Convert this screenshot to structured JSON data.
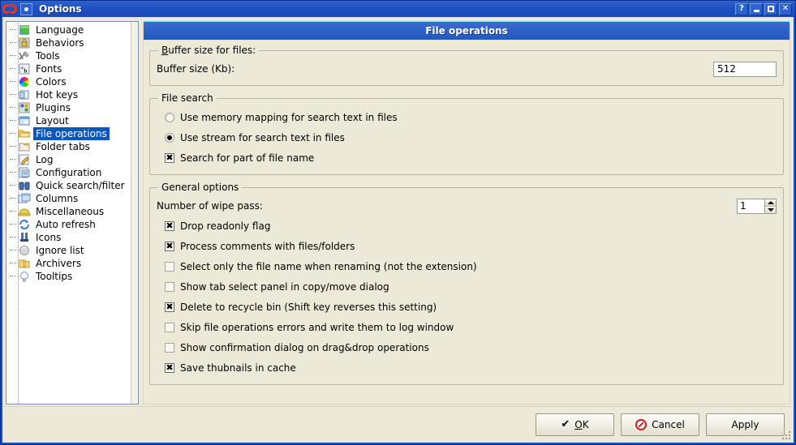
{
  "window": {
    "title": "Options",
    "app_icon": "double-c-app-icon",
    "buttons": {
      "help": "?",
      "minimize": "minimize",
      "maximize": "maximize",
      "close": "✕"
    }
  },
  "sidebar": {
    "selected": "File operations",
    "items": [
      {
        "label": "Language",
        "icon": "green-flag-icon"
      },
      {
        "label": "Behaviors",
        "icon": "lock-icon"
      },
      {
        "label": "Tools",
        "icon": "tools-icon"
      },
      {
        "label": "Fonts",
        "icon": "font-ab-icon"
      },
      {
        "label": "Colors",
        "icon": "color-wheel-icon"
      },
      {
        "label": "Hot keys",
        "icon": "keyboard-key-icon"
      },
      {
        "label": "Plugins",
        "icon": "plugin-blocks-icon"
      },
      {
        "label": "Layout",
        "icon": "layout-window-icon"
      },
      {
        "label": "File operations",
        "icon": "open-folder-icon"
      },
      {
        "label": "Folder tabs",
        "icon": "folder-tab-icon"
      },
      {
        "label": "Log",
        "icon": "pencil-note-icon"
      },
      {
        "label": "Configuration",
        "icon": "config-doc-icon"
      },
      {
        "label": "Quick search/filter",
        "icon": "binoculars-icon"
      },
      {
        "label": "Columns",
        "icon": "columns-icon"
      },
      {
        "label": "Miscellaneous",
        "icon": "hard-hat-icon"
      },
      {
        "label": "Auto refresh",
        "icon": "refresh-arrows-icon"
      },
      {
        "label": "Icons",
        "icon": "boots-icon"
      },
      {
        "label": "Ignore list",
        "icon": "gray-ball-icon"
      },
      {
        "label": "Archivers",
        "icon": "zip-folder-icon"
      },
      {
        "label": "Tooltips",
        "icon": "lightbulb-icon"
      }
    ]
  },
  "page": {
    "title": "File operations",
    "buffer_group": {
      "legend_accel": "B",
      "legend_rest": "uffer size for files:",
      "field_label": "Buffer size (Kb):",
      "field_value": "512"
    },
    "file_search_group": {
      "legend": "File search",
      "options": [
        {
          "type": "radio",
          "label": "Use memory mapping for search text in files",
          "checked": false
        },
        {
          "type": "radio",
          "label": "Use stream for search text in files",
          "checked": true
        },
        {
          "type": "checkbox",
          "label": "Search for part of file name",
          "checked": true
        }
      ]
    },
    "general_group": {
      "legend": "General options",
      "wipe_label": "Number of wipe pass:",
      "wipe_value": "1",
      "options": [
        {
          "type": "checkbox",
          "label": "Drop readonly flag",
          "checked": true
        },
        {
          "type": "checkbox",
          "label": "Process comments with files/folders",
          "checked": true
        },
        {
          "type": "checkbox",
          "label": "Select only the file name when renaming (not the extension)",
          "checked": false
        },
        {
          "type": "checkbox",
          "label": "Show tab select panel in copy/move dialog",
          "checked": false
        },
        {
          "type": "checkbox",
          "label": "Delete to recycle bin (Shift key reverses this setting)",
          "checked": true
        },
        {
          "type": "checkbox",
          "label": "Skip file operations errors and write them to log window",
          "checked": false
        },
        {
          "type": "checkbox",
          "label": "Show confirmation dialog on drag&drop operations",
          "checked": false
        },
        {
          "type": "checkbox",
          "label": "Save thubnails in cache",
          "checked": true
        }
      ]
    }
  },
  "footer": {
    "ok": {
      "accel": "O",
      "rest": "K",
      "icon": "checkmark-icon"
    },
    "cancel": {
      "label": "Cancel",
      "icon": "deny-circle-icon"
    },
    "apply": {
      "label": "Apply"
    }
  },
  "colors": {
    "titlebar": "#1f50c2",
    "page_title": "#2f62cf",
    "face": "#ece9d8",
    "selection": "#0a57c2",
    "accent_red": "#d01f1f"
  }
}
